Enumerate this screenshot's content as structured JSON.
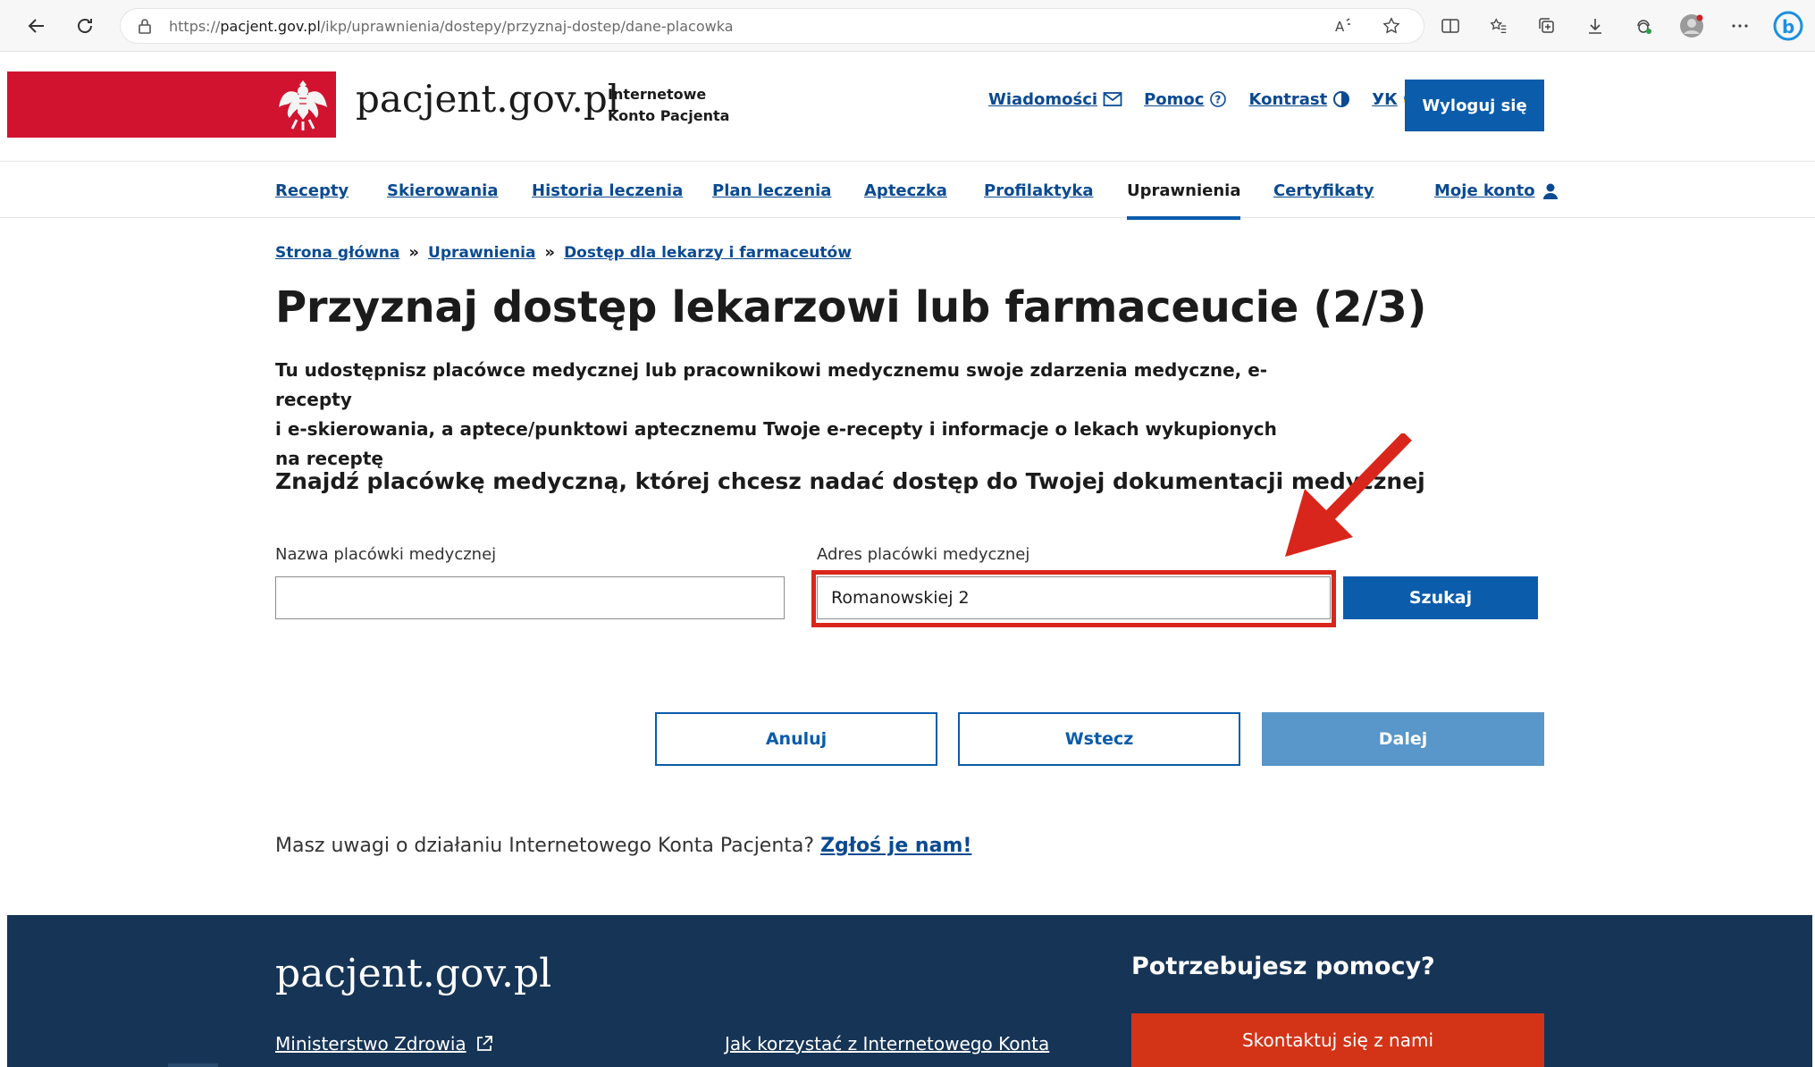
{
  "browser": {
    "url_prefix": "https://",
    "url_host": "pacjent.gov.pl",
    "url_path": "/ikp/uprawnienia/dostepy/przyznaj-dostep/dane-placowka"
  },
  "header": {
    "brand": "pacjent.gov.pl",
    "subtitle_line1": "Internetowe",
    "subtitle_line2": "Konto Pacjenta",
    "links": {
      "messages": "Wiadomości",
      "help": "Pomoc",
      "contrast": "Kontrast",
      "language": "УК"
    },
    "logout": "Wyloguj się"
  },
  "nav": {
    "items": [
      "Recepty",
      "Skierowania",
      "Historia leczenia",
      "Plan leczenia",
      "Apteczka",
      "Profilaktyka",
      "Uprawnienia",
      "Certyfikaty",
      "Moje konto"
    ],
    "active": "Uprawnienia"
  },
  "breadcrumb": {
    "home": "Strona główna",
    "level1": "Uprawnienia",
    "level2": "Dostęp dla lekarzy i farmaceutów",
    "separator": "»"
  },
  "main": {
    "title": "Przyznaj dostęp lekarzowi lub farmaceucie (2/3)",
    "intro_line1": "Tu udostępnisz placówce medycznej lub pracownikowi medycznemu swoje zdarzenia medyczne, e-recepty",
    "intro_line2": "i e-skierowania, a aptece/punktowi aptecznemu Twoje e-recepty i informacje o lekach wykupionych na receptę",
    "section_title": "Znajdź placówkę medyczną, której chcesz nadać dostęp do Twojej dokumentacji medycznej",
    "facility_name_label": "Nazwa placówki medycznej",
    "facility_name_value": "",
    "facility_address_label": "Adres placówki medycznej",
    "facility_address_value": "Romanowskiej 2",
    "search_button": "Szukaj",
    "cancel_button": "Anuluj",
    "back_button": "Wstecz",
    "next_button": "Dalej",
    "feedback_text": "Masz uwagi o działaniu Internetowego Konta Pacjenta?",
    "feedback_link": "Zgłoś je nam!"
  },
  "footer": {
    "brand": "pacjent.gov.pl",
    "link_ministry": "Ministerstwo Zdrowia",
    "link_howto": "Jak korzystać z Internetowego Konta",
    "help_title": "Potrzebujesz pomocy?",
    "contact_button": "Skontaktuj się z nami"
  },
  "colors": {
    "primary": "#0b5cab",
    "link": "#0b4a91",
    "brand_red": "#d1132f",
    "footer_bg": "#163456",
    "contact_orange": "#d33417",
    "highlight_red": "#d9261c",
    "disabled_blue": "#5996c9"
  },
  "icons": [
    "back-icon",
    "refresh-icon",
    "lock-icon",
    "read-aloud-icon",
    "favorite-star-icon",
    "split-screen-icon",
    "favorites-icon",
    "collections-icon",
    "download-icon",
    "extensions-icon",
    "profile-avatar-icon",
    "more-icon",
    "bing-icon",
    "eagle-emblem-icon",
    "mail-icon",
    "help-circle-icon",
    "contrast-icon",
    "ukraine-flag-icon",
    "user-icon",
    "external-link-icon",
    "annotation-arrow-icon"
  ]
}
